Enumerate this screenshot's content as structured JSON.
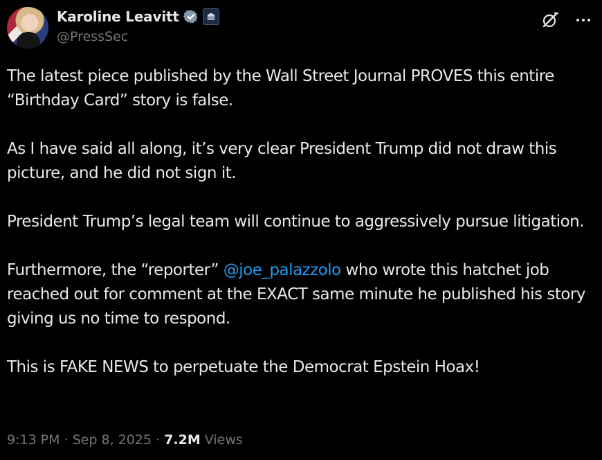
{
  "author": {
    "name": "Karoline Leavitt",
    "handle": "@PressSec",
    "verified_color": "#829aab",
    "affiliation_badge": "white-house-seal-icon"
  },
  "actions": {
    "grok_icon": "grok-icon",
    "more_icon": "more-options-icon"
  },
  "tweet": {
    "p1": "The latest piece published by the Wall Street Journal PROVES this entire “Birthday Card” story is false.",
    "p2": "As I have said all along, it’s very clear President Trump did not draw this picture, and he did not sign it.",
    "p3": "President Trump’s legal team will continue to aggressively pursue litigation.",
    "p4_before": "Furthermore, the “reporter” ",
    "p4_mention": "@joe_palazzolo",
    "p4_after": " who wrote this hatchet job reached out for comment at the EXACT same minute he published his story giving us no time to respond.",
    "p5": "This is FAKE NEWS to perpetuate the Democrat Epstein Hoax!"
  },
  "meta": {
    "time": "9:13 PM",
    "sep1": " · ",
    "date": "Sep 8, 2025",
    "sep2": " · ",
    "views_count": "7.2M",
    "views_label": " Views"
  },
  "colors": {
    "background": "#000000",
    "text": "#e7e9ea",
    "secondary": "#71767b",
    "link": "#1d9bf0"
  }
}
